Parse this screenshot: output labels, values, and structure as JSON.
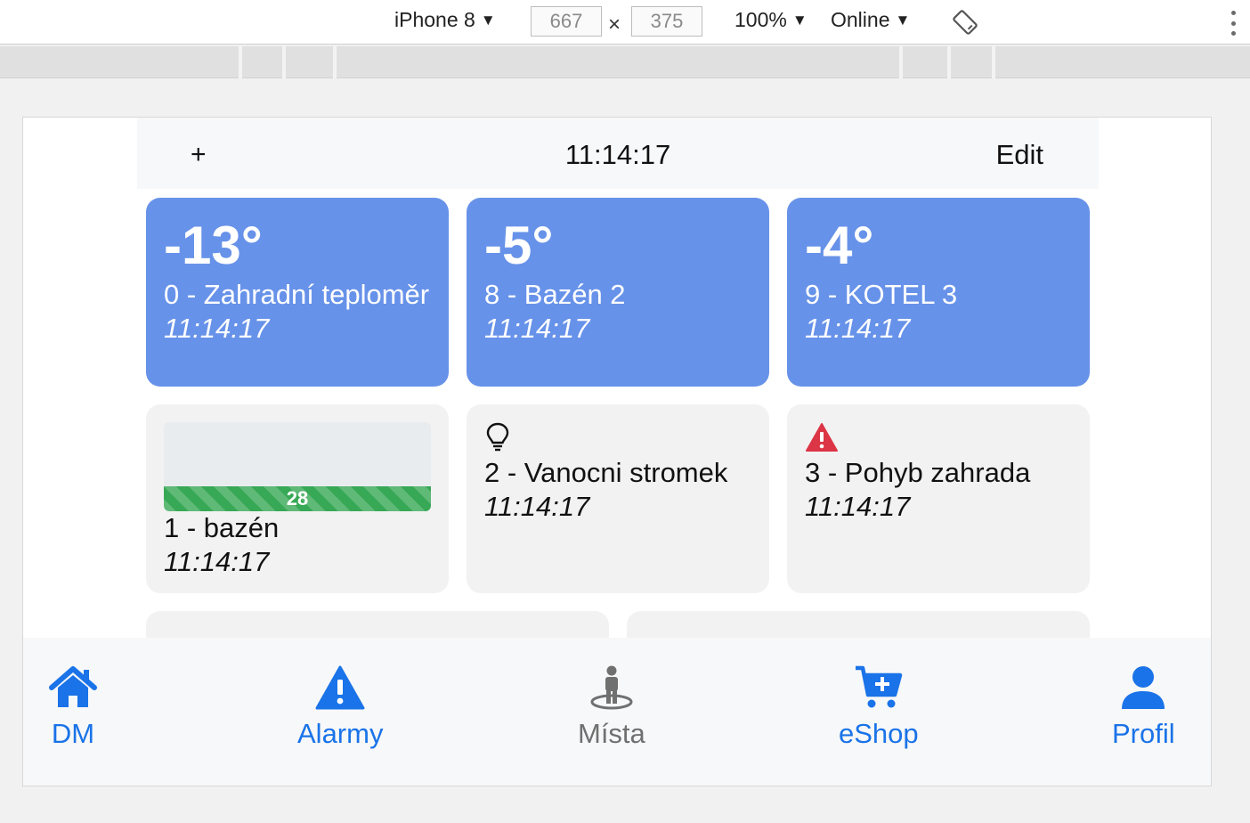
{
  "devtools": {
    "device": "iPhone 8",
    "width": "667",
    "height": "375",
    "times": "×",
    "zoom": "100%",
    "network": "Online",
    "caret": "▼"
  },
  "header": {
    "add_label": "+",
    "time": "11:14:17",
    "edit_label": "Edit"
  },
  "cards": [
    {
      "temp": "-13°",
      "name": "0 - Zahradní teploměr",
      "time": "11:14:17",
      "style": "blue"
    },
    {
      "temp": "-5°",
      "name": "8 - Bazén 2",
      "time": "11:14:17",
      "style": "blue"
    },
    {
      "temp": "-4°",
      "name": "9 - KOTEL 3",
      "time": "11:14:17",
      "style": "blue"
    },
    {
      "progress_value": "28",
      "progress_fraction": 0.28,
      "name": "1 - bazén",
      "time": "11:14:17",
      "style": "grey"
    },
    {
      "icon": "lightbulb-icon",
      "name": "2 - Vanocni stromek",
      "time": "11:14:17",
      "style": "grey"
    },
    {
      "icon": "warning-icon",
      "name": "3 - Pohyb zahrada",
      "time": "11:14:17",
      "style": "grey"
    }
  ],
  "nav": [
    {
      "label": "DM",
      "icon": "home-icon"
    },
    {
      "label": "Alarmy",
      "icon": "warning-icon"
    },
    {
      "label": "Místa",
      "icon": "person-location-icon"
    },
    {
      "label": "eShop",
      "icon": "cart-plus-icon"
    },
    {
      "label": "Profil",
      "icon": "user-icon"
    }
  ],
  "colors": {
    "blue_card": "#6792e9",
    "accent": "#1a73e8",
    "progress": "#37a855",
    "alert": "#dc3545"
  }
}
